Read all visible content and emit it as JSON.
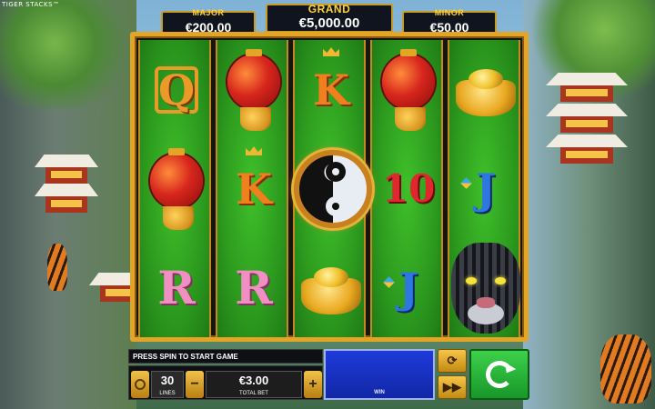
{
  "game": {
    "title": "TIGER STACKS™"
  },
  "jackpots": {
    "major": {
      "label": "MAJOR",
      "value": "€200.00"
    },
    "grand": {
      "label": "GRAND",
      "value": "€5,000.00"
    },
    "minor": {
      "label": "MINOR",
      "value": "€50.00"
    }
  },
  "reels": [
    [
      "Q",
      "lantern",
      "R"
    ],
    [
      "lantern",
      "K",
      "R"
    ],
    [
      "K",
      "yin-yang",
      "gold-ingot"
    ],
    [
      "lantern",
      "10",
      "J"
    ],
    [
      "gold-ingot",
      "J",
      "tiger"
    ]
  ],
  "reel_letters": {
    "r1c1": "Q",
    "r1c3": "R",
    "r2c2": "K",
    "r2c3": "R",
    "r3c1": "K",
    "r4c2": "10",
    "r4c3": "J",
    "r5c2": "J"
  },
  "controls": {
    "message": "PRESS SPIN TO START GAME",
    "lines_value": "30",
    "lines_label": "LINES",
    "bet_value": "€3.00",
    "bet_label": "TOTAL BET",
    "win_label": "WIN",
    "minus": "−",
    "plus": "+"
  },
  "colors": {
    "frame": "#e2a525",
    "reel_green": "#2c9a1e",
    "spin_green": "#18962a",
    "win_blue": "#1227a6"
  }
}
